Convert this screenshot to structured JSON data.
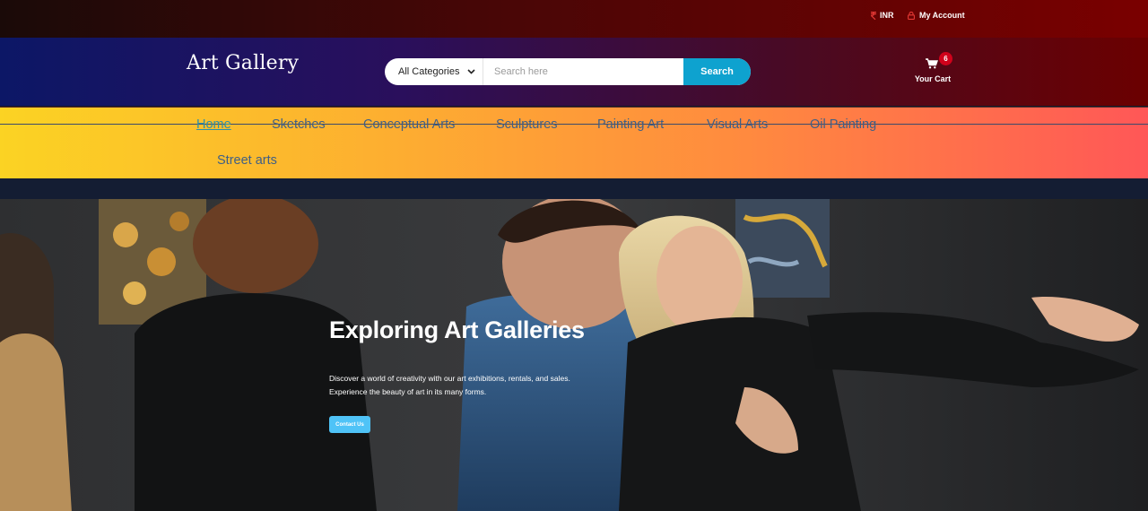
{
  "topbar": {
    "currency": "INR",
    "account": "My Account",
    "icons": {
      "currency": "rupee-icon",
      "account": "lock-icon"
    }
  },
  "header": {
    "logo": "Art Gallery",
    "search": {
      "category_selected": "All Categories",
      "placeholder": "Search here",
      "value": "",
      "button": "Search"
    },
    "cart": {
      "count": "6",
      "label": "Your Cart",
      "icon": "cart-icon"
    }
  },
  "nav": {
    "items": [
      {
        "label": "Home",
        "active": true
      },
      {
        "label": "Sketches"
      },
      {
        "label": "Conceptual Arts"
      },
      {
        "label": "Sculptures"
      },
      {
        "label": "Painting Art"
      },
      {
        "label": "Visual Arts"
      },
      {
        "label": "Oil Painting"
      },
      {
        "label": "Street arts"
      }
    ]
  },
  "hero": {
    "title": "Exploring Art Galleries",
    "description": "Discover a world of creativity with our art exhibitions, rentals, and sales. Experience the beauty of art in its many forms.",
    "cta": "Contact Us"
  },
  "colors": {
    "search_button": "#0ea2cf",
    "badge": "#d0021b",
    "cta": "#4fc3f7",
    "nav_text": "#3f5f86"
  }
}
